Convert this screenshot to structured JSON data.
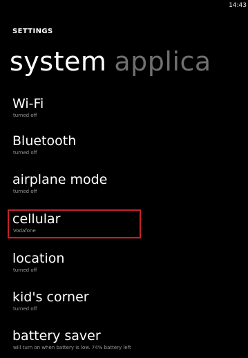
{
  "status_bar": {
    "time": "14:43"
  },
  "header": {
    "app_title": "SETTINGS"
  },
  "pivot": {
    "active": "system",
    "next": "applica"
  },
  "settings": [
    {
      "title": "Wi-Fi",
      "status": "turned off"
    },
    {
      "title": "Bluetooth",
      "status": "turned off"
    },
    {
      "title": "airplane mode",
      "status": "turned off"
    },
    {
      "title": "cellular",
      "status": "Vodafone"
    },
    {
      "title": "location",
      "status": "turned off"
    },
    {
      "title": "kid's corner",
      "status": "turned off"
    },
    {
      "title": "battery saver",
      "status": "will turn on when battery is low. 74% battery left"
    }
  ],
  "colors": {
    "background": "#000000",
    "text": "#ffffff",
    "subtext": "#9a9a9a",
    "inactive_pivot": "#6f6f6f",
    "highlight": "#c8202a"
  }
}
